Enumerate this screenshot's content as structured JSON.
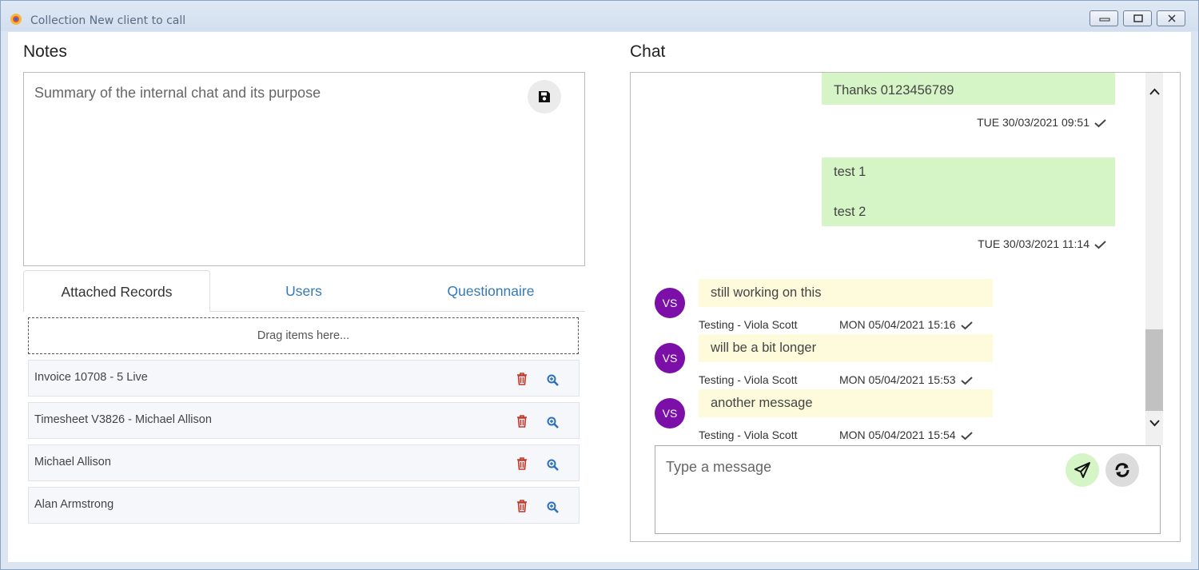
{
  "window": {
    "title": "Collection New client to call",
    "colors": {
      "frame": "#dce6f3",
      "accent_link": "#337ab7"
    }
  },
  "notes": {
    "heading": "Notes",
    "text": "Summary of the internal chat and its purpose",
    "save_icon": "floppy-disk-icon"
  },
  "tabs": [
    {
      "label": "Attached Records",
      "active": true
    },
    {
      "label": "Users",
      "active": false
    },
    {
      "label": "Questionnaire",
      "active": false
    }
  ],
  "attached": {
    "dropzone": "Drag items here...",
    "records": [
      {
        "label": "Invoice 10708 - 5 Live"
      },
      {
        "label": "Timesheet V3826 - Michael Allison"
      },
      {
        "label": "Michael Allison"
      },
      {
        "label": "Alan Armstrong"
      }
    ]
  },
  "chat": {
    "heading": "Chat",
    "messages": [
      {
        "direction": "out",
        "lines": [
          "Thanks 0123456789"
        ],
        "timestamp": "TUE 30/03/2021 09:51"
      },
      {
        "direction": "out",
        "lines": [
          "test 1",
          "test 2"
        ],
        "timestamp": "TUE 30/03/2021 11:14"
      },
      {
        "direction": "in",
        "initials": "VS",
        "text": "still working on this",
        "sender": "Testing - Viola Scott",
        "timestamp": "MON 05/04/2021 15:16"
      },
      {
        "direction": "in",
        "initials": "VS",
        "text": "will be a bit longer",
        "sender": "Testing - Viola Scott",
        "timestamp": "MON 05/04/2021 15:53"
      },
      {
        "direction": "in",
        "initials": "VS",
        "text": "another message",
        "sender": "Testing - Viola Scott",
        "timestamp": "MON 05/04/2021 15:54"
      }
    ],
    "composer": {
      "placeholder": "Type a message"
    },
    "colors": {
      "outgoing": "#d6f5c6",
      "incoming": "#fdfbdb",
      "avatar": "#7b0fa8"
    }
  }
}
